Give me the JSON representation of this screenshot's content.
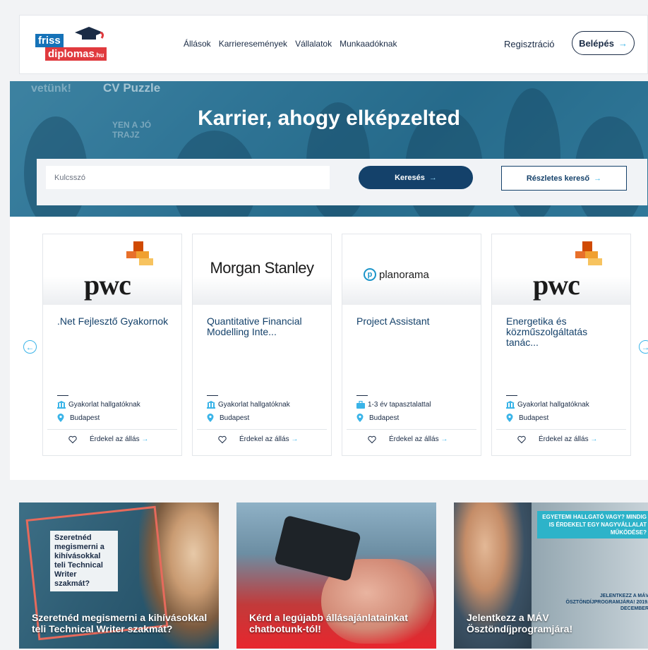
{
  "header": {
    "logo_top": "friss",
    "logo_bottom": "diplomas",
    "logo_tld": ".hu",
    "nav": [
      "Állások",
      "Karrieresemények",
      "Vállalatok",
      "Munkaadóknak"
    ],
    "register": "Regisztráció",
    "login": "Belépés",
    "login_arrow": "→"
  },
  "hero": {
    "title": "Karrier, ahogy elképzelted",
    "bg_text_left": "vetünk!",
    "bg_text_cv": "CV Puzzle",
    "bg_text_sign": "YEN A JÓ\nTRAJZ",
    "search": {
      "keyword_placeholder": "Kulcsszó",
      "search_label": "Keresés",
      "advanced_label": "Részletes kereső",
      "arrow": "→"
    }
  },
  "carousel": {
    "prev_icon": "←",
    "next_icon": "→",
    "cards": [
      {
        "company": "pwc",
        "title": ".Net Fejlesztő Gyakornok",
        "type": "Gyakorlat hallgatóknak",
        "type_icon": "building-icon",
        "location": "Budapest",
        "interest": "Érdekel az állás"
      },
      {
        "company": "Morgan Stanley",
        "title": "Quantitative Financial Modelling Inte...",
        "type": "Gyakorlat hallgatóknak",
        "type_icon": "building-icon",
        "location": "Budapest",
        "interest": "Érdekel az állás"
      },
      {
        "company": "planorama",
        "title": "Project Assistant",
        "type": "1-3 év tapasztalattal",
        "type_icon": "briefcase-icon",
        "location": "Budapest",
        "interest": "Érdekel az állás"
      },
      {
        "company": "pwc",
        "title": "Energetika és közműszolgáltatás tanác...",
        "type": "Gyakorlat hallgatóknak",
        "type_icon": "building-icon",
        "location": "Budapest",
        "interest": "Érdekel az állás"
      }
    ],
    "arrow": "→"
  },
  "promos": [
    {
      "caption": "Szeretnéd megismerni a kihívásokkal teli Technical Writer szakmát?",
      "note": "Szeretnéd megismerni a kihívásokkal teli Technical Writer szakmát?"
    },
    {
      "caption": "Kérd a legújabb állásajánlatainkat chatbotunk-tól!"
    },
    {
      "caption": "Jelentkezz a MÁV Ösztöndíjprogramjára!",
      "banner": "EGYETEMI HALLGATÓ VAGY? MINDIG IS ÉRDEKELT EGY NAGYVÁLLALAT MŰKÖDÉSE?",
      "small": "JELENTKEZZ A MÁV ÖSZTÖNDÍJPROGRAMJÁRA! 2019. DECEMBER"
    }
  ],
  "colors": {
    "navy": "#14416a",
    "accent": "#3ab4e8",
    "logo_blue": "#1572b8",
    "logo_red": "#e03a3e",
    "pwc_orange": "#e8702a"
  }
}
